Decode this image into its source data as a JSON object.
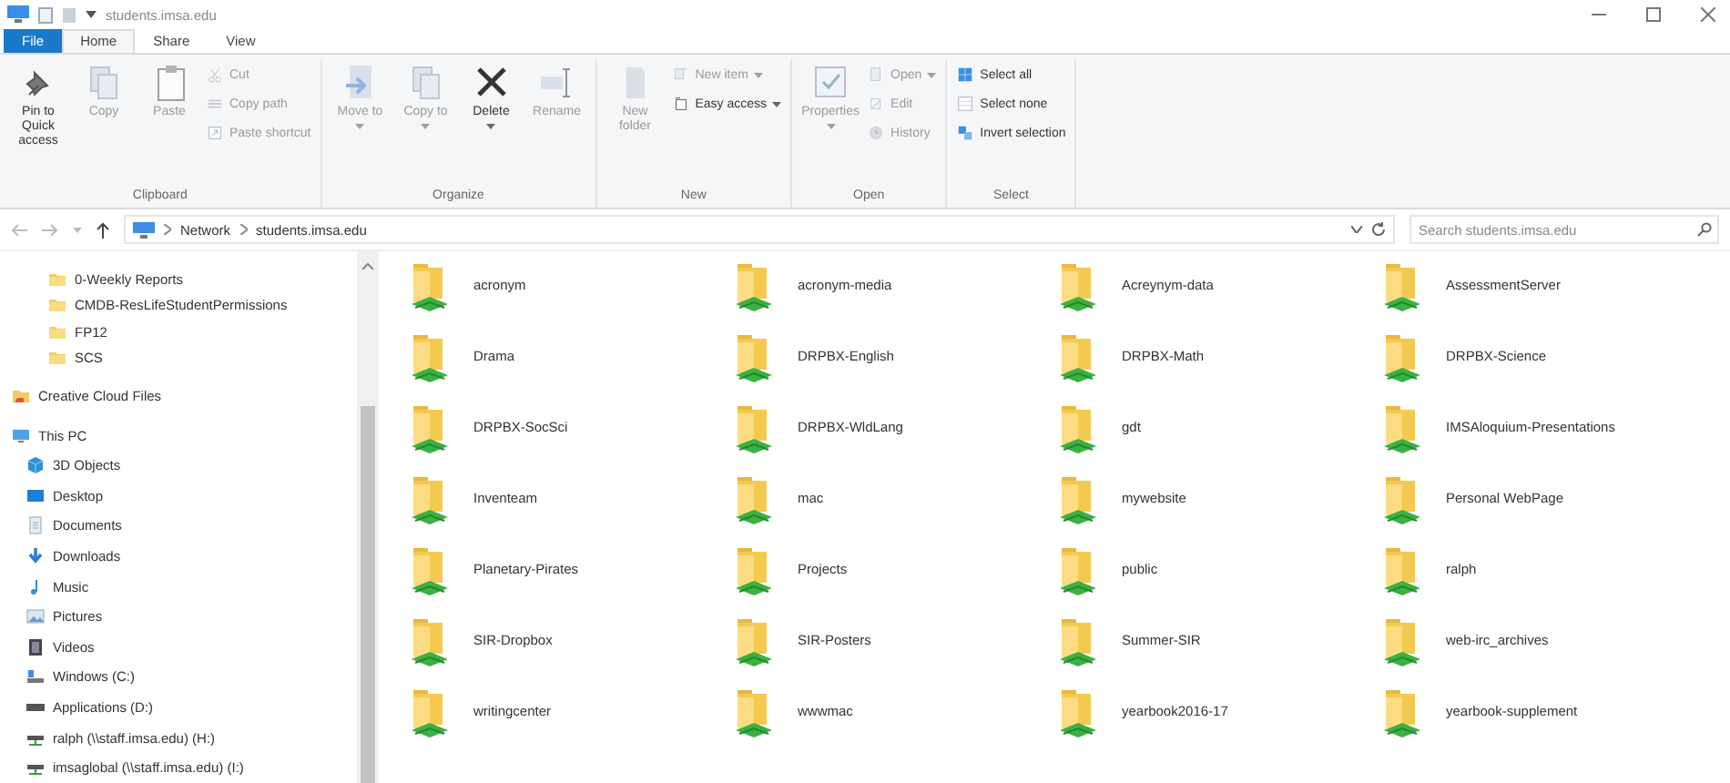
{
  "window": {
    "title": "students.imsa.edu"
  },
  "ribbon_tabs": [
    {
      "label": "File",
      "kind": "file",
      "selected": false
    },
    {
      "label": "Home",
      "kind": "tab",
      "selected": true
    },
    {
      "label": "Share",
      "kind": "tab",
      "selected": false
    },
    {
      "label": "View",
      "kind": "tab",
      "selected": false
    }
  ],
  "ribbon_groups": [
    {
      "label": "Clipboard",
      "buttons": [
        {
          "label": "Pin to Quick access",
          "kind": "large",
          "disabled": false
        },
        {
          "label": "Copy",
          "kind": "large",
          "disabled": true
        },
        {
          "label": "Paste",
          "kind": "large",
          "disabled": true
        },
        {
          "label": "Cut",
          "kind": "small",
          "disabled": true
        },
        {
          "label": "Copy path",
          "kind": "small",
          "disabled": true
        },
        {
          "label": "Paste shortcut",
          "kind": "small",
          "disabled": true
        }
      ]
    },
    {
      "label": "Organize",
      "buttons": [
        {
          "label": "Move to",
          "kind": "large",
          "disabled": true,
          "dropdown": true
        },
        {
          "label": "Copy to",
          "kind": "large",
          "disabled": true,
          "dropdown": true
        },
        {
          "label": "Delete",
          "kind": "large",
          "disabled": false,
          "dropdown": true
        },
        {
          "label": "Rename",
          "kind": "large",
          "disabled": true
        }
      ]
    },
    {
      "label": "New",
      "buttons": [
        {
          "label": "New folder",
          "kind": "large",
          "disabled": true
        },
        {
          "label": "New item",
          "kind": "small",
          "disabled": true,
          "dropdown": true
        },
        {
          "label": "Easy access",
          "kind": "small",
          "disabled": false,
          "dropdown": true
        }
      ]
    },
    {
      "label": "Open",
      "buttons": [
        {
          "label": "Properties",
          "kind": "large",
          "disabled": true,
          "dropdown": true
        },
        {
          "label": "Open",
          "kind": "small",
          "disabled": true,
          "dropdown": true
        },
        {
          "label": "Edit",
          "kind": "small",
          "disabled": true
        },
        {
          "label": "History",
          "kind": "small",
          "disabled": true
        }
      ]
    },
    {
      "label": "Select",
      "buttons": [
        {
          "label": "Select all",
          "kind": "small",
          "disabled": false
        },
        {
          "label": "Select none",
          "kind": "small",
          "disabled": false
        },
        {
          "label": "Invert selection",
          "kind": "small",
          "disabled": false
        }
      ]
    }
  ],
  "address_bar": {
    "breadcrumbs": [
      "Network",
      "students.imsa.edu"
    ]
  },
  "search": {
    "placeholder": "Search students.imsa.edu"
  },
  "sidebar": {
    "quick_access_items": [
      {
        "label": "0-Weekly Reports"
      },
      {
        "label": "CMDB-ResLifeStudentPermissions"
      },
      {
        "label": "FP12"
      },
      {
        "label": "SCS"
      }
    ],
    "items": [
      {
        "label": "Creative Cloud Files"
      },
      {
        "label": "This PC",
        "children": [
          {
            "label": "3D Objects"
          },
          {
            "label": "Desktop"
          },
          {
            "label": "Documents"
          },
          {
            "label": "Downloads"
          },
          {
            "label": "Music"
          },
          {
            "label": "Pictures"
          },
          {
            "label": "Videos"
          },
          {
            "label": "Windows (C:)"
          },
          {
            "label": "Applications (D:)"
          },
          {
            "label": "ralph (\\\\staff.imsa.edu) (H:)"
          },
          {
            "label": "imsaglobal (\\\\staff.imsa.edu) (I:)"
          }
        ]
      }
    ]
  },
  "folders": [
    "acronym",
    "acronym-media",
    "Acreynym-data",
    "AssessmentServer",
    "Drama",
    "DRPBX-English",
    "DRPBX-Math",
    "DRPBX-Science",
    "DRPBX-SocSci",
    "DRPBX-WldLang",
    "gdt",
    "IMSAloquium-Presentations",
    "Inventeam",
    "mac",
    "mywebsite",
    "Personal WebPage",
    "Planetary-Pirates",
    "Projects",
    "public",
    "ralph",
    "SIR-Dropbox",
    "SIR-Posters",
    "Summer-SIR",
    "web-irc_archives",
    "writingcenter",
    "wwwmac",
    "yearbook2016-17",
    "yearbook-supplement"
  ]
}
